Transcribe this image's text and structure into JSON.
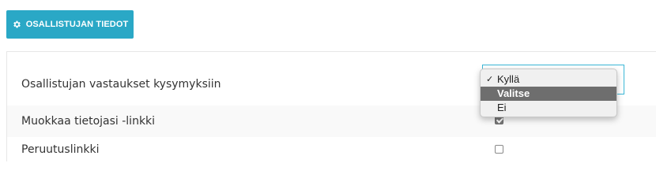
{
  "toolbar": {
    "participant_info_label": "OSALLISTUJAN TIEDOT",
    "icon": "gear-icon"
  },
  "settings": {
    "rows": [
      {
        "label": "Osallistujan vastaukset kysymyksiin"
      },
      {
        "label": "Muokkaa tietojasi -linkki",
        "checked": true
      },
      {
        "label": "Peruutuslinkki",
        "checked": false
      }
    ]
  },
  "dropdown": {
    "options": [
      {
        "label": "Kyllä",
        "checked": true
      },
      {
        "label": "Valitse",
        "highlighted": true
      },
      {
        "label": "Ei"
      }
    ],
    "check_mark": "✓"
  },
  "colors": {
    "accent": "#2aa8c6",
    "highlight": "#6e6e6e"
  }
}
